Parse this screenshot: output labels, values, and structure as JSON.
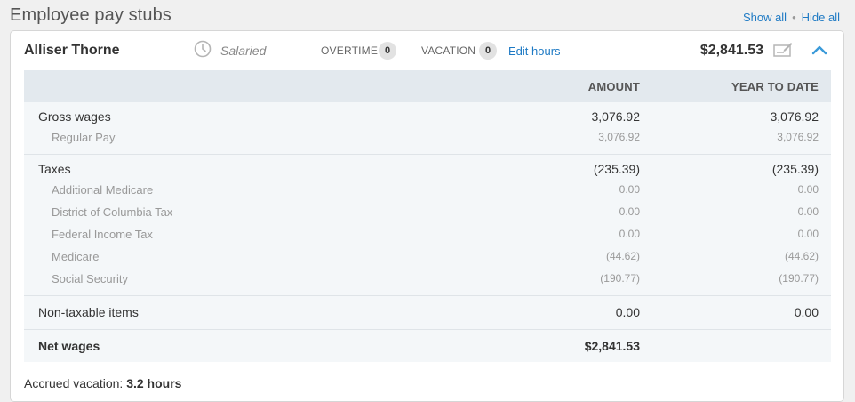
{
  "page": {
    "title": "Employee pay stubs",
    "show_all": "Show all",
    "separator": "•",
    "hide_all": "Hide all"
  },
  "employee": {
    "name": "Alliser Thorne",
    "pay_type": "Salaried",
    "overtime_label": "OVERTIME",
    "overtime_count": "0",
    "vacation_label": "VACATION",
    "vacation_count": "0",
    "edit_hours": "Edit hours",
    "net_total": "$2,841.53"
  },
  "table": {
    "col_amount": "AMOUNT",
    "col_ytd": "YEAR TO DATE",
    "gross": {
      "label": "Gross wages",
      "amount": "3,076.92",
      "ytd": "3,076.92"
    },
    "gross_items": [
      {
        "label": "Regular Pay",
        "amount": "3,076.92",
        "ytd": "3,076.92"
      }
    ],
    "taxes": {
      "label": "Taxes",
      "amount": "(235.39)",
      "ytd": "(235.39)"
    },
    "tax_items": [
      {
        "label": "Additional Medicare",
        "amount": "0.00",
        "ytd": "0.00"
      },
      {
        "label": "District of Columbia Tax",
        "amount": "0.00",
        "ytd": "0.00"
      },
      {
        "label": "Federal Income Tax",
        "amount": "0.00",
        "ytd": "0.00"
      },
      {
        "label": "Medicare",
        "amount": "(44.62)",
        "ytd": "(44.62)"
      },
      {
        "label": "Social Security",
        "amount": "(190.77)",
        "ytd": "(190.77)"
      }
    ],
    "nontaxable": {
      "label": "Non-taxable items",
      "amount": "0.00",
      "ytd": "0.00"
    },
    "net": {
      "label": "Net wages",
      "amount": "$2,841.53"
    }
  },
  "accrued": {
    "label": "Accrued vacation:",
    "value": "3.2 hours"
  },
  "icons": {
    "clock": "clock-icon",
    "check": "pay-check-icon",
    "collapse": "chevron-up-icon"
  },
  "colors": {
    "link": "#1e7ac4",
    "table_header_bg": "#e3e9ee",
    "table_body_bg": "#f4f7f9"
  }
}
